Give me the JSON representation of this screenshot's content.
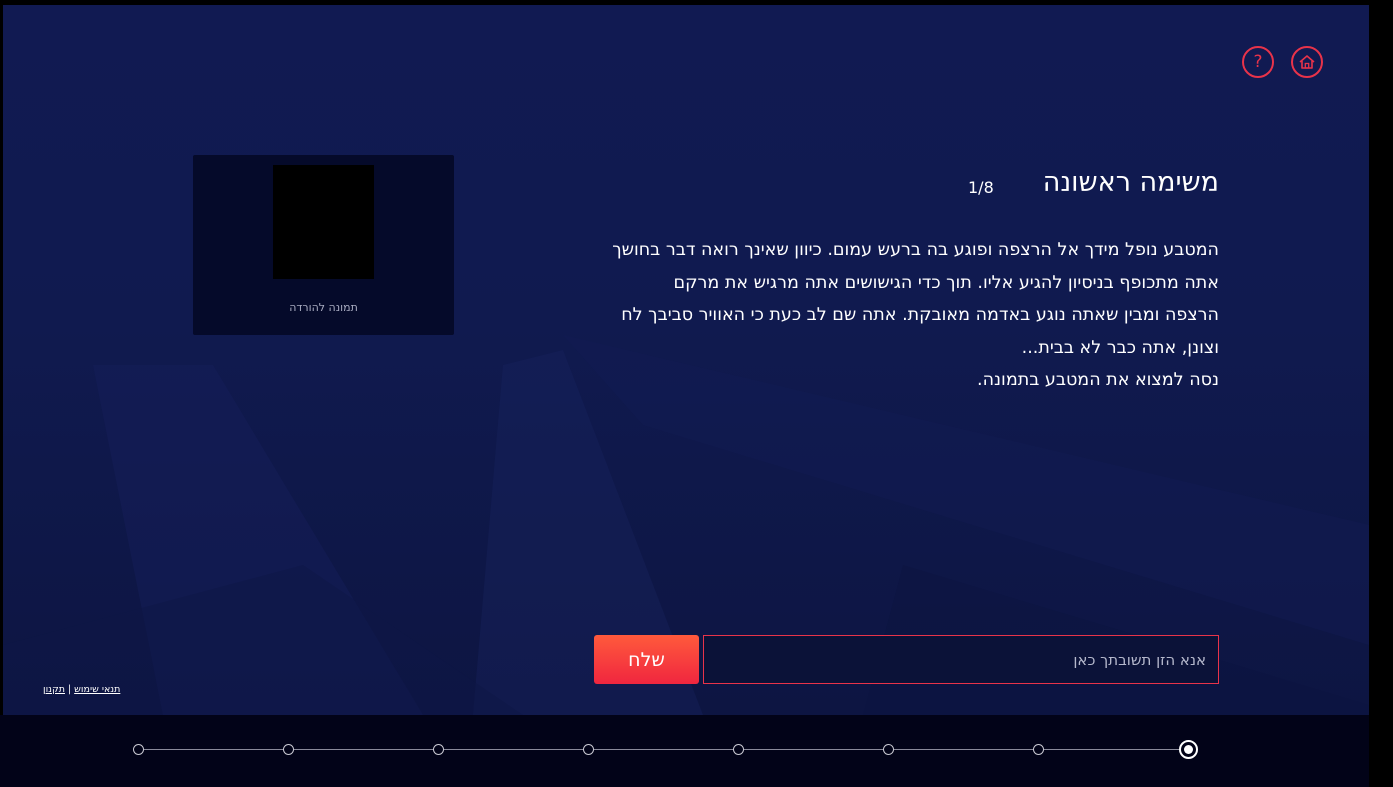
{
  "header": {
    "help_glyph": "?",
    "help_icon": "question-icon",
    "home_icon": "home-icon"
  },
  "task": {
    "title": "משימה ראשונה",
    "counter": "1/8",
    "lines": [
      "המטבע נופל מידך אל הרצפה ופוגע בה ברעש עמום. כיוון שאינך רואה דבר בחושך",
      "אתה מתכופף בניסיון להגיע אליו. תוך כדי הגישושים אתה מרגיש את מרקם",
      "הרצפה ומבין שאתה נוגע באדמה מאובקת. אתה שם לב כעת כי האוויר סביבך לח",
      "וצונן, אתה כבר לא בבית...",
      "נסה למצוא את המטבע בתמונה."
    ]
  },
  "image_panel": {
    "caption": "תמונה להורדה"
  },
  "answer": {
    "placeholder": "אנא הזן תשובתך כאן",
    "value": "",
    "submit_label": "שלח"
  },
  "legal": {
    "terms": "תנאי שימוש",
    "separator": "|",
    "regulations": "תקנון"
  },
  "progress": {
    "total_steps": 8,
    "current_step": 1
  },
  "colors": {
    "accent": "#e8334a",
    "background": "#111a52",
    "footer": "#020318"
  }
}
